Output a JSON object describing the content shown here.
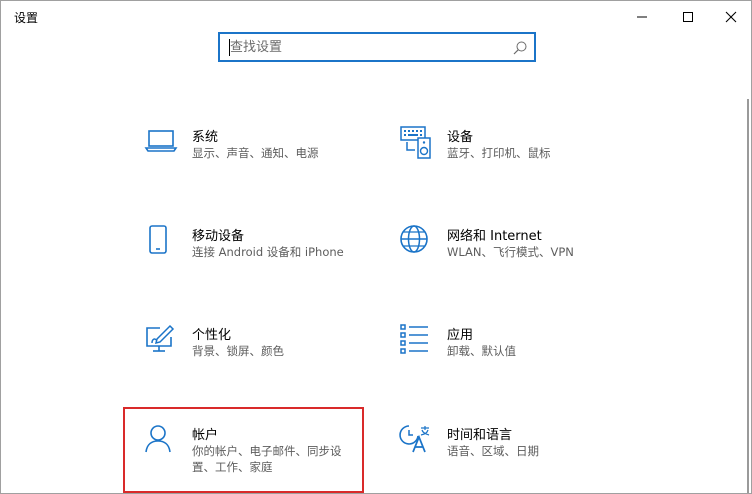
{
  "window": {
    "title": "设置"
  },
  "search": {
    "placeholder": "查找设置"
  },
  "categories": [
    {
      "title": "系统",
      "desc": "显示、声音、通知、电源",
      "icon": "laptop-icon"
    },
    {
      "title": "设备",
      "desc": "蓝牙、打印机、鼠标",
      "icon": "devices-icon"
    },
    {
      "title": "移动设备",
      "desc": "连接 Android 设备和 iPhone",
      "icon": "phone-icon"
    },
    {
      "title": "网络和 Internet",
      "desc": "WLAN、飞行模式、VPN",
      "icon": "globe-icon"
    },
    {
      "title": "个性化",
      "desc": "背景、锁屏、颜色",
      "icon": "personalization-icon"
    },
    {
      "title": "应用",
      "desc": "卸载、默认值",
      "icon": "apps-list-icon"
    },
    {
      "title": "帐户",
      "desc": "你的帐户、电子邮件、同步设",
      "desc2": "置、工作、家庭",
      "icon": "person-icon"
    },
    {
      "title": "时间和语言",
      "desc": "语音、区域、日期",
      "icon": "time-language-icon"
    }
  ],
  "colors": {
    "accent": "#1b74c8",
    "highlight": "#d92a2a"
  }
}
